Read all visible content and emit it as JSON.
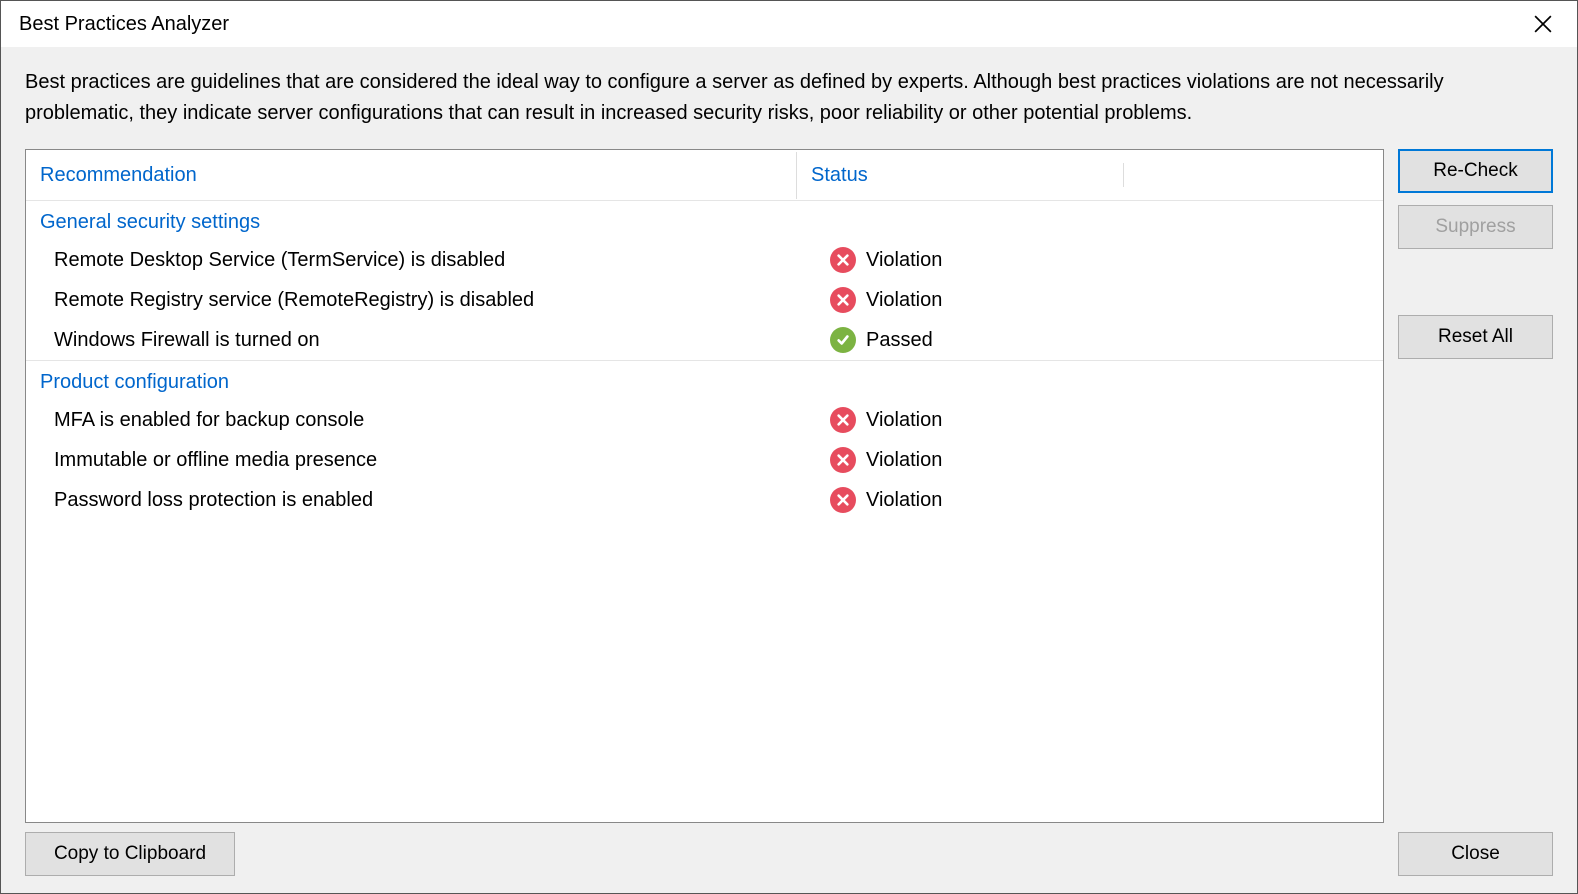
{
  "window": {
    "title": "Best Practices Analyzer"
  },
  "description": "Best practices are guidelines that are considered the ideal way to configure a server as defined by experts. Although best practices violations are not necessarily problematic, they indicate server configurations that can result in increased security risks, poor reliability or other potential problems.",
  "columns": {
    "recommendation": "Recommendation",
    "status": "Status"
  },
  "groups": [
    {
      "name": "General security settings",
      "items": [
        {
          "recommendation": "Remote Desktop Service (TermService) is disabled",
          "status": "Violation"
        },
        {
          "recommendation": "Remote Registry service (RemoteRegistry) is disabled",
          "status": "Violation"
        },
        {
          "recommendation": "Windows Firewall is turned on",
          "status": "Passed"
        }
      ]
    },
    {
      "name": "Product configuration",
      "items": [
        {
          "recommendation": "MFA is enabled for backup console",
          "status": "Violation"
        },
        {
          "recommendation": "Immutable or offline media presence",
          "status": "Violation"
        },
        {
          "recommendation": "Password loss protection is enabled",
          "status": "Violation"
        }
      ]
    }
  ],
  "buttons": {
    "recheck": "Re-Check",
    "suppress": "Suppress",
    "reset_all": "Reset All",
    "copy": "Copy to Clipboard",
    "close": "Close"
  }
}
